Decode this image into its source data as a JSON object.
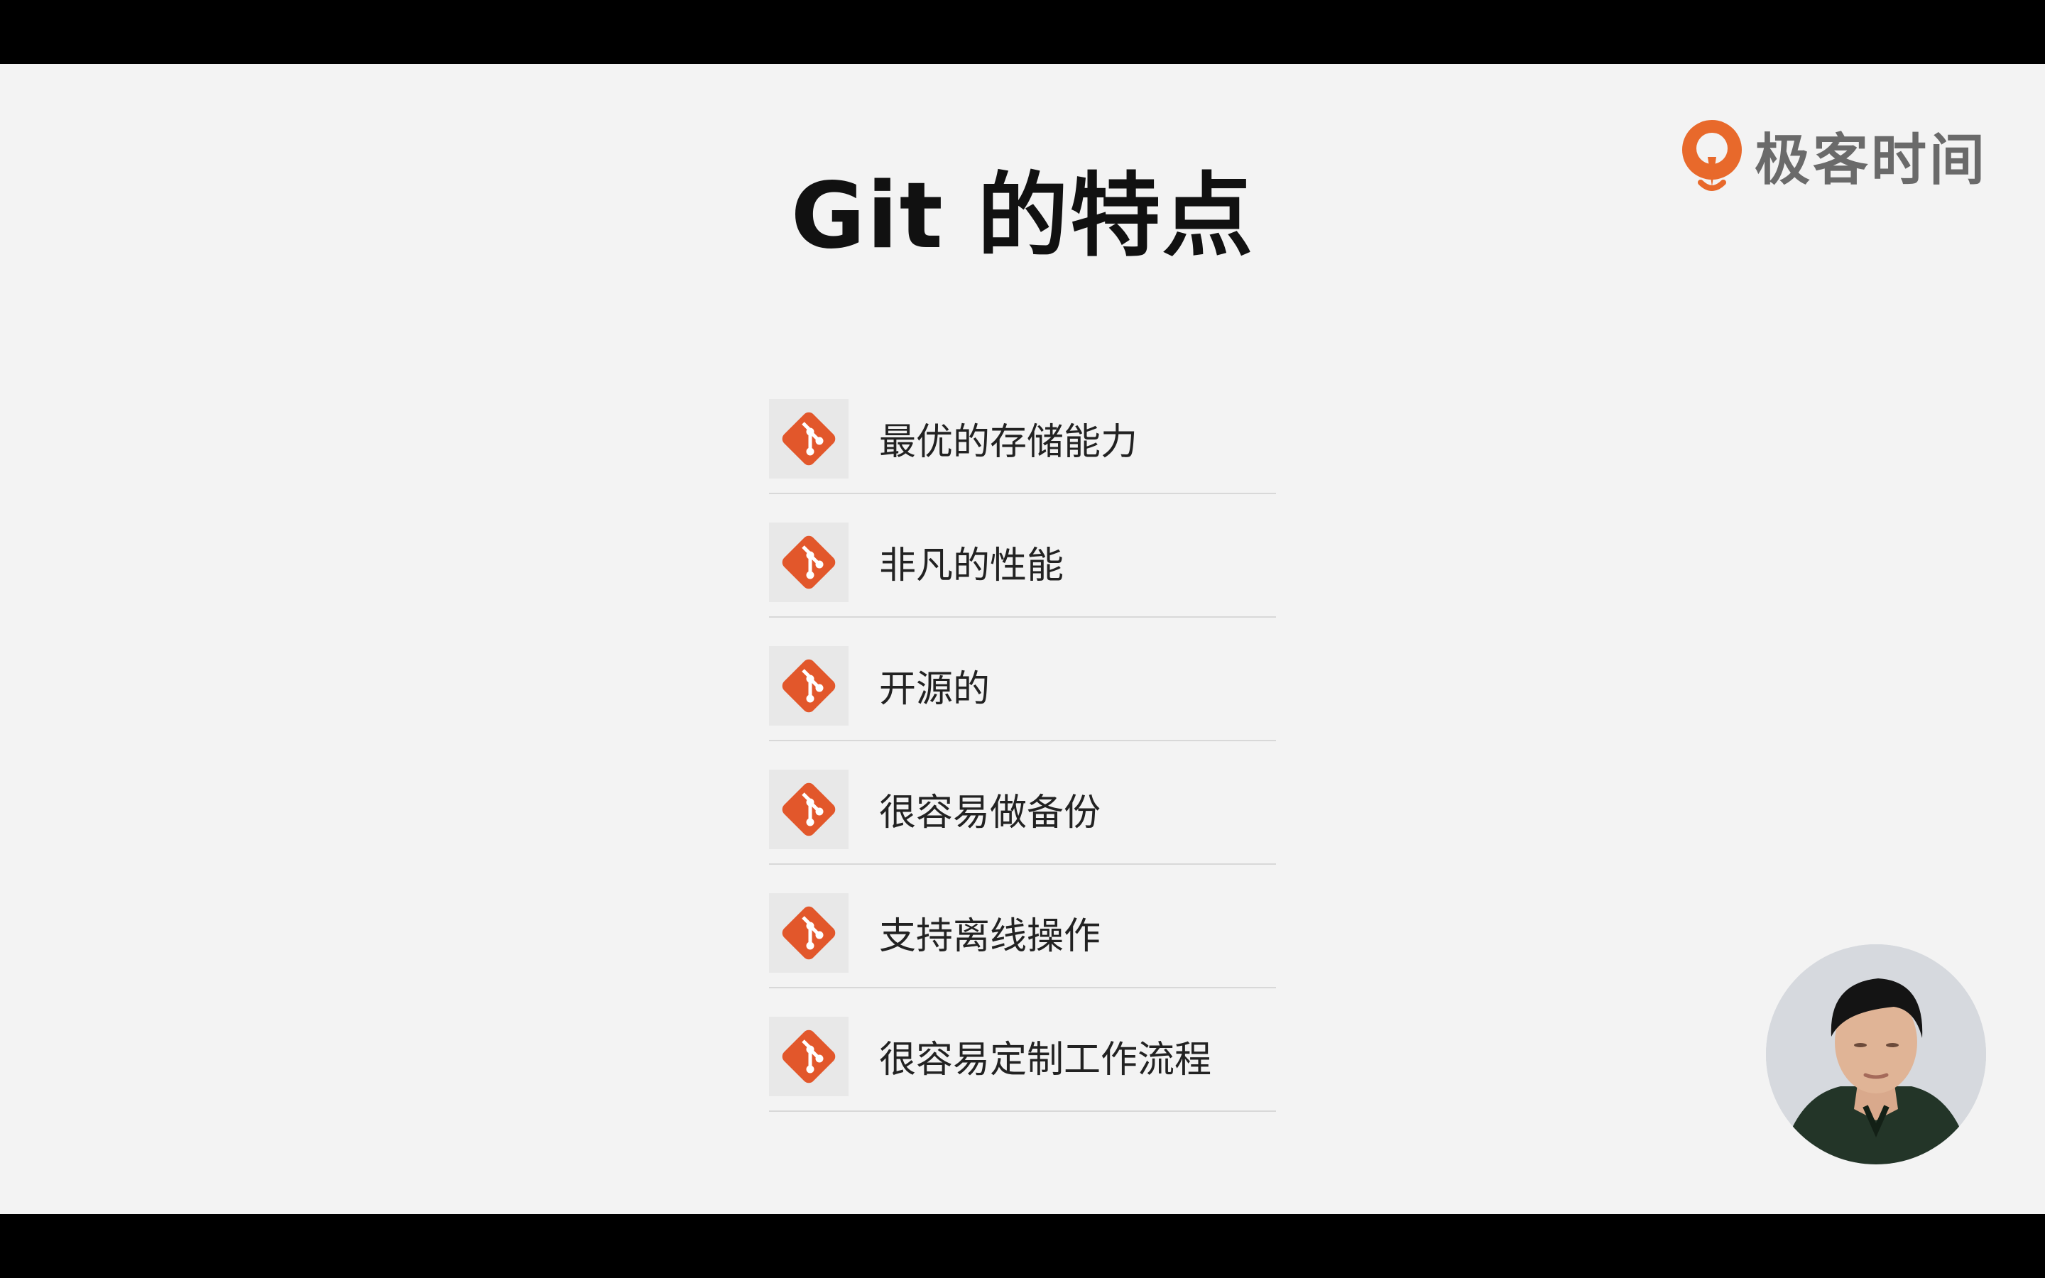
{
  "slide": {
    "title": "Git 的特点",
    "brand": {
      "name": "极客时间",
      "accent": "#e8692b"
    },
    "features": [
      {
        "label": "最优的存储能力",
        "icon": "git-icon"
      },
      {
        "label": "非凡的性能",
        "icon": "git-icon"
      },
      {
        "label": "开源的",
        "icon": "git-icon"
      },
      {
        "label": "很容易做备份",
        "icon": "git-icon"
      },
      {
        "label": "支持离线操作",
        "icon": "git-icon"
      },
      {
        "label": "很容易定制工作流程",
        "icon": "git-icon"
      }
    ],
    "git_icon_color": "#e2572b",
    "presenter": {
      "icon": "presenter-video"
    }
  }
}
